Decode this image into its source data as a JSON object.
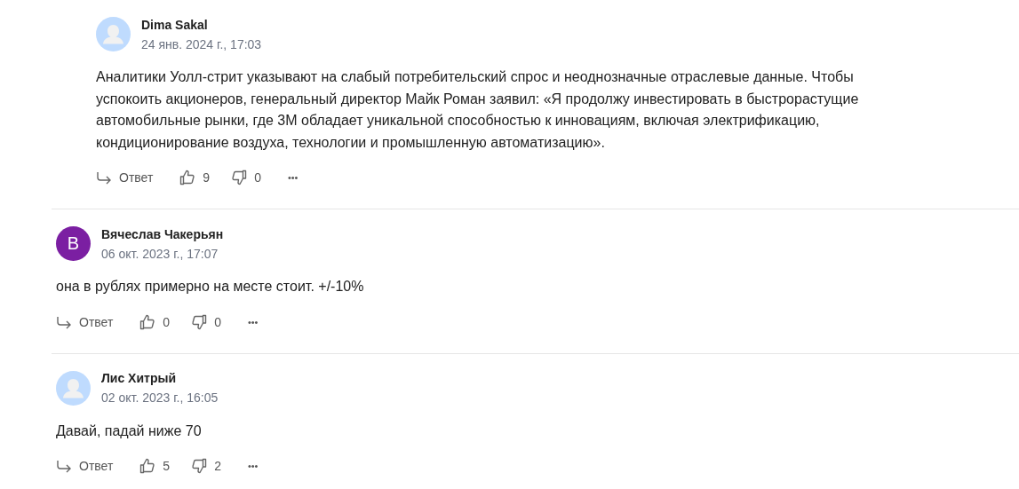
{
  "replies": [
    {
      "author": "Dima Sakal",
      "date": "24 янв. 2024 г., 17:03",
      "avatar": {
        "kind": "placeholder"
      },
      "text": "Аналитики Уолл-стрит указывают на слабый потребительский спрос и неоднозначные отраслевые данные. Чтобы успокоить акционеров, генеральный директор Майк Роман заявил: «Я продолжу инвестировать в быстрорастущие автомобильные рынки, где 3M обладает уникальной способностью к инновациям, включая электрификацию, кондиционирование воздуха, технологии и промышленную автоматизацию».",
      "reply_label": "Ответ",
      "likes": "9",
      "dislikes": "0",
      "more": "•••"
    }
  ],
  "comments": [
    {
      "author": "Вячеслав Чакерьян",
      "date": "06 окт. 2023 г., 17:07",
      "avatar": {
        "kind": "initial",
        "letter": "B",
        "color": "#7b1fa2"
      },
      "text": "она в рублях примерно на месте стоит. +/-10%",
      "reply_label": "Ответ",
      "likes": "0",
      "dislikes": "0",
      "more": "•••"
    },
    {
      "author": "Лис Хитрый",
      "date": "02 окт. 2023 г., 16:05",
      "avatar": {
        "kind": "placeholder"
      },
      "text": "Давай, падай ниже 70",
      "reply_label": "Ответ",
      "likes": "5",
      "dislikes": "2",
      "more": "•••"
    }
  ]
}
